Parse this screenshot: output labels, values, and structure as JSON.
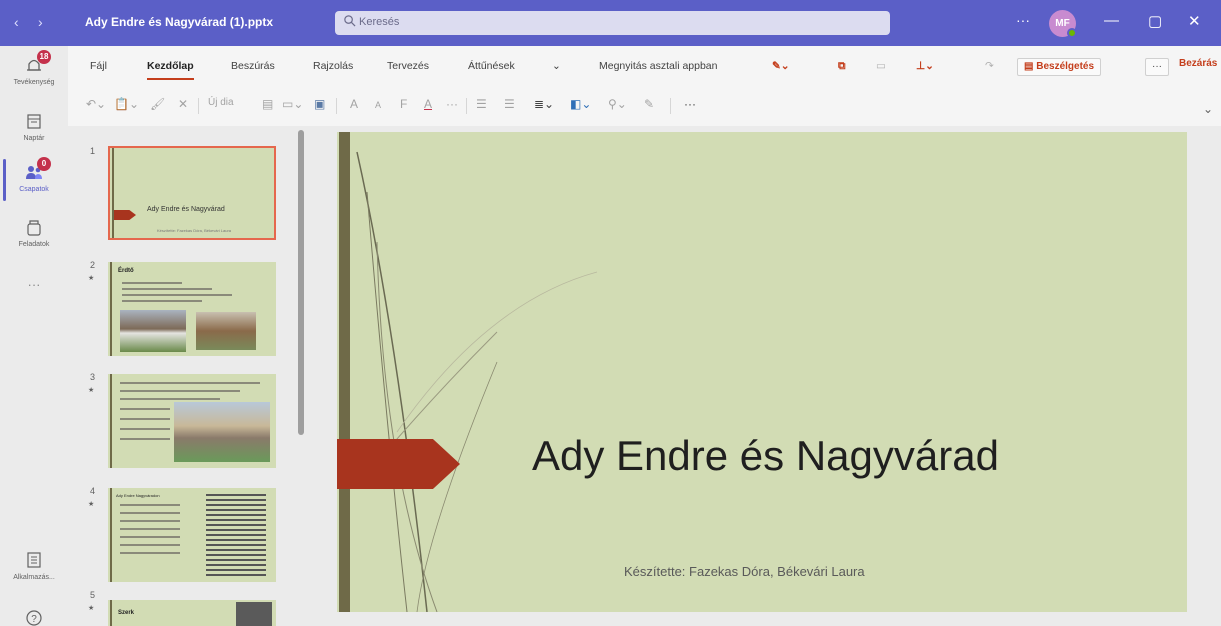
{
  "titlebar": {
    "back_glyph": "‹",
    "forward_glyph": "›",
    "filename": "Ady Endre és Nagyvárad (1).pptx",
    "search_placeholder": "Keresés",
    "more_glyph": "···",
    "avatar_initials": "MF",
    "minimize_glyph": "—",
    "maximize_glyph": "▢",
    "close_glyph": "✕",
    "color": "#5b5fc7"
  },
  "rail": {
    "items": [
      {
        "label": "Tevékenység",
        "icon": "bell-icon",
        "badge": "18"
      },
      {
        "label": "Naptár",
        "icon": "calendar-icon"
      },
      {
        "label": "Csapatok",
        "icon": "teams-icon",
        "badge": "0"
      },
      {
        "label": "Feladatok",
        "icon": "tasks-icon"
      },
      {
        "label": "···",
        "icon": "more-icon"
      },
      {
        "label": "Alkalmazás...",
        "icon": "apps-icon"
      },
      {
        "label": "",
        "icon": "help-icon"
      }
    ]
  },
  "ribbon": {
    "menu": [
      "Fájl",
      "Kezdőlap",
      "Beszúrás",
      "Rajzolás",
      "Tervezés",
      "Áttűnések"
    ],
    "active_tab": "Kezdőlap",
    "dropdown_glyph": "⌄",
    "open_desktop": "Megnyitás asztali appban",
    "conversation": "Beszélgetés",
    "more": "···",
    "close": "Bezárás",
    "accent_color": "#c43e1c"
  },
  "toolbar": {
    "undo": "↶⌄",
    "clipboard": "📋⌄",
    "format_painter": "🖌",
    "cut": "✕",
    "new_slide": "Új dia",
    "font_grow": "A",
    "font_shrink": "A",
    "bold": "F",
    "underline_a": "A",
    "more": "···",
    "expand": "⌄"
  },
  "thumbnails": [
    {
      "num": "1",
      "title": "Ady Endre és Nagyvárad",
      "subtitle": "Készítette: Fazekas Dóra, Békevári Laura",
      "selected": true
    },
    {
      "num": "2",
      "heading": "Érdtő"
    },
    {
      "num": "3"
    },
    {
      "num": "4",
      "heading": "Ady Endre Nagyváradon"
    },
    {
      "num": "5",
      "heading": "Szerk"
    }
  ],
  "slide": {
    "title": "Ady Endre és Nagyvárad",
    "subtitle": "Készítette: Fazekas Dóra, Békevári Laura",
    "background": "#d2dcb4",
    "accent_arrow": "#a8341e"
  }
}
